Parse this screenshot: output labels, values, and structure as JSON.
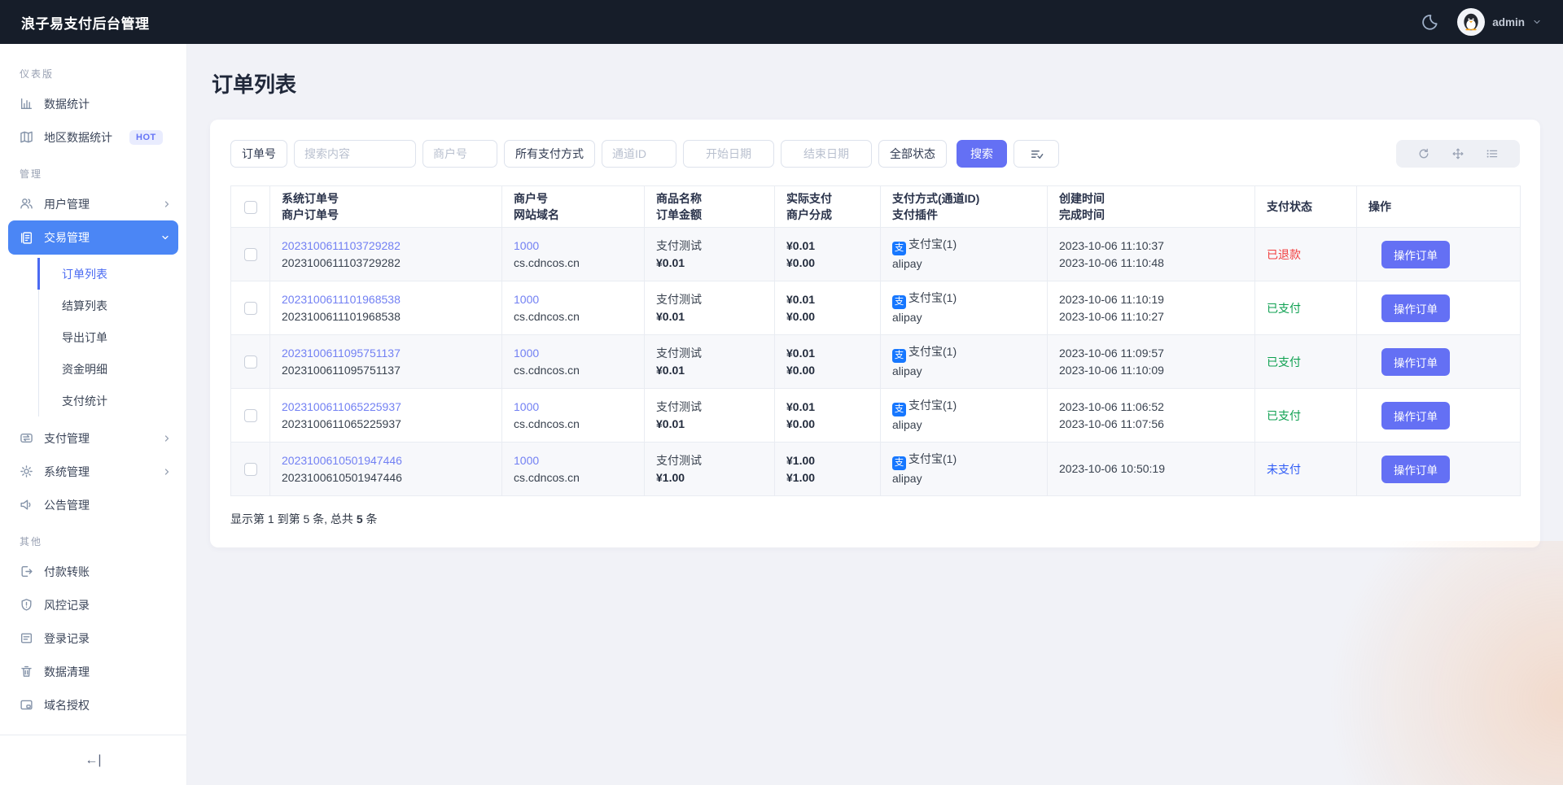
{
  "navbar": {
    "title": "浪子易支付后台管理",
    "username": "admin"
  },
  "sidebar": {
    "sections": [
      {
        "label": "仪表版",
        "items": [
          {
            "label": "数据统计",
            "icon": "bar-chart"
          },
          {
            "label": "地区数据统计",
            "icon": "map",
            "badge": "HOT"
          }
        ]
      },
      {
        "label": "管理",
        "items": [
          {
            "label": "用户管理",
            "icon": "users"
          },
          {
            "label": "交易管理",
            "icon": "invoice",
            "children": [
              {
                "label": "订单列表"
              },
              {
                "label": "结算列表"
              },
              {
                "label": "导出订单"
              },
              {
                "label": "资金明细"
              },
              {
                "label": "支付统计"
              }
            ]
          },
          {
            "label": "支付管理",
            "icon": "transfer"
          },
          {
            "label": "系统管理",
            "icon": "gear"
          },
          {
            "label": "公告管理",
            "icon": "speaker"
          }
        ]
      },
      {
        "label": "其他",
        "items": [
          {
            "label": "付款转账",
            "icon": "export"
          },
          {
            "label": "风控记录",
            "icon": "shield"
          },
          {
            "label": "登录记录",
            "icon": "document"
          },
          {
            "label": "数据清理",
            "icon": "trash"
          },
          {
            "label": "域名授权",
            "icon": "window"
          }
        ]
      }
    ],
    "collapse_icon": "←|"
  },
  "page": {
    "title": "订单列表"
  },
  "filters": {
    "order_field": "订单号",
    "search_placeholder": "搜索内容",
    "merchant_placeholder": "商户号",
    "pay_method": "所有支付方式",
    "channel_placeholder": "通道ID",
    "start_date_placeholder": "开始日期",
    "end_date_placeholder": "结束日期",
    "status_filter": "全部状态",
    "search_button": "搜索"
  },
  "icons": {
    "alipay_glyph": "支"
  },
  "table": {
    "headers": [
      {
        "line1": "系统订单号",
        "line2": "商户订单号"
      },
      {
        "line1": "商户号",
        "line2": "网站域名"
      },
      {
        "line1": "商品名称",
        "line2": "订单金额"
      },
      {
        "line1": "实际支付",
        "line2": "商户分成"
      },
      {
        "line1": "支付方式(通道ID)",
        "line2": "支付插件"
      },
      {
        "line1": "创建时间",
        "line2": "完成时间"
      },
      {
        "line1": "支付状态",
        "line2": ""
      },
      {
        "line1": "操作",
        "line2": ""
      }
    ],
    "action_label": "操作订单",
    "rows": [
      {
        "sys_order": "2023100611103729282",
        "mch_order": "2023100611103729282",
        "merchant": "1000",
        "domain": "cs.cdncos.cn",
        "product": "支付测试",
        "amount": "¥0.01",
        "paid": "¥0.01",
        "share": "¥0.00",
        "method": "支付宝(1)",
        "plugin": "alipay",
        "created": "2023-10-06 11:10:37",
        "finished": "2023-10-06 11:10:48",
        "status": "已退款",
        "status_type": "refunded"
      },
      {
        "sys_order": "2023100611101968538",
        "mch_order": "2023100611101968538",
        "merchant": "1000",
        "domain": "cs.cdncos.cn",
        "product": "支付测试",
        "amount": "¥0.01",
        "paid": "¥0.01",
        "share": "¥0.00",
        "method": "支付宝(1)",
        "plugin": "alipay",
        "created": "2023-10-06 11:10:19",
        "finished": "2023-10-06 11:10:27",
        "status": "已支付",
        "status_type": "paid"
      },
      {
        "sys_order": "2023100611095751137",
        "mch_order": "2023100611095751137",
        "merchant": "1000",
        "domain": "cs.cdncos.cn",
        "product": "支付测试",
        "amount": "¥0.01",
        "paid": "¥0.01",
        "share": "¥0.00",
        "method": "支付宝(1)",
        "plugin": "alipay",
        "created": "2023-10-06 11:09:57",
        "finished": "2023-10-06 11:10:09",
        "status": "已支付",
        "status_type": "paid"
      },
      {
        "sys_order": "2023100611065225937",
        "mch_order": "2023100611065225937",
        "merchant": "1000",
        "domain": "cs.cdncos.cn",
        "product": "支付测试",
        "amount": "¥0.01",
        "paid": "¥0.01",
        "share": "¥0.00",
        "method": "支付宝(1)",
        "plugin": "alipay",
        "created": "2023-10-06 11:06:52",
        "finished": "2023-10-06 11:07:56",
        "status": "已支付",
        "status_type": "paid"
      },
      {
        "sys_order": "2023100610501947446",
        "mch_order": "2023100610501947446",
        "merchant": "1000",
        "domain": "cs.cdncos.cn",
        "product": "支付测试",
        "amount": "¥1.00",
        "paid": "¥1.00",
        "share": "¥1.00",
        "method": "支付宝(1)",
        "plugin": "alipay",
        "created": "2023-10-06 10:50:19",
        "finished": "",
        "status": "未支付",
        "status_type": "unpaid"
      }
    ]
  },
  "summary": {
    "prefix": "显示第 1 到第 5 条, 总共 ",
    "total": "5",
    "suffix": " 条"
  },
  "colors": {
    "accent": "#6470f4",
    "sidebar_active": "#4b86f5",
    "navbar_bg": "#161d29",
    "status_refunded": "#f23d3d",
    "status_paid": "#0da050",
    "status_unpaid": "#2e5bf6",
    "alipay_blue": "#1677ff",
    "link": "#7280f3"
  }
}
